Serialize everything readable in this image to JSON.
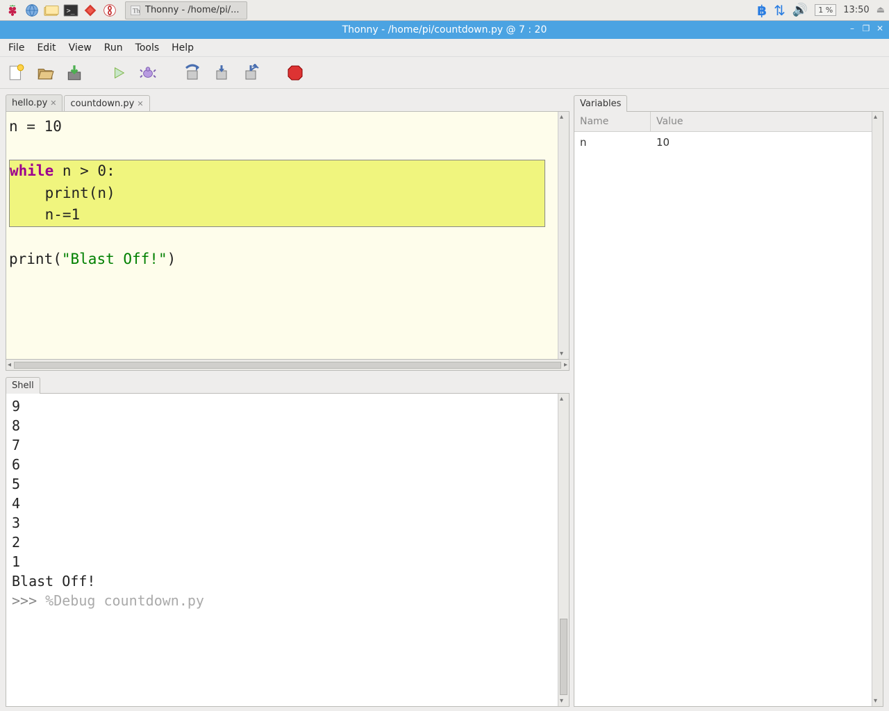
{
  "taskbar": {
    "app_title": "Thonny  -  /home/pi/...",
    "cpu": "1 %",
    "clock": "13:50"
  },
  "window": {
    "title": "Thonny  -  /home/pi/countdown.py  @  7 : 20"
  },
  "menus": [
    "File",
    "Edit",
    "View",
    "Run",
    "Tools",
    "Help"
  ],
  "editor_tabs": [
    {
      "label": "hello.py",
      "active": false
    },
    {
      "label": "countdown.py",
      "active": true
    }
  ],
  "code": {
    "line1_pre": "n = ",
    "line1_val": "10",
    "block_l1_kw": "while",
    "block_l1_rest": " n > 0:",
    "block_l2": "    print(n)",
    "block_l3": "    n-=1",
    "after_fn": "print",
    "after_paren_open": "(",
    "after_str": "\"Blast Off!\"",
    "after_paren_close": ")"
  },
  "shell_tab": "Shell",
  "shell_output": [
    "9",
    "8",
    "7",
    "6",
    "5",
    "4",
    "3",
    "2",
    "1",
    "Blast Off!"
  ],
  "shell_prompt": ">>> ",
  "shell_cmd": "%Debug countdown.py",
  "variables_tab": "Variables",
  "var_head_name": "Name",
  "var_head_value": "Value",
  "variables": [
    {
      "name": "n",
      "value": "10"
    }
  ]
}
